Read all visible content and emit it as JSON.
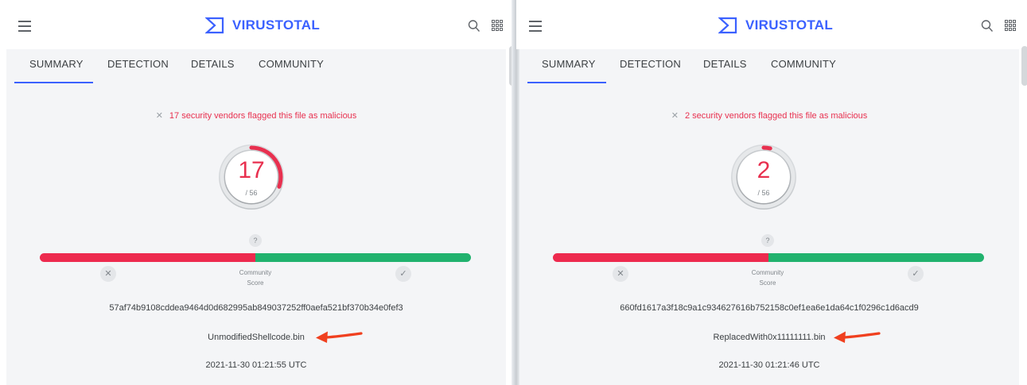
{
  "colors": {
    "brand": "#3b61ff",
    "malicious": "#e8304f",
    "bar_red": "#ed2a4e",
    "bar_green": "#21b26e",
    "annotation_arrow": "#f0401f"
  },
  "panels": [
    {
      "brand_name": "VIRUSTOTAL",
      "tabs": [
        "SUMMARY",
        "DETECTION",
        "DETAILS",
        "COMMUNITY"
      ],
      "active_tab": "SUMMARY",
      "flag_icon": "x-icon",
      "flag_text": "17 security vendors flagged this file as malicious",
      "score": "17",
      "score_total": "/ 56",
      "score_fraction": 0.3036,
      "question_mark": "?",
      "community_score_label": "Community\nScore",
      "community_score_fraction": 0.5,
      "hash": "57af74b9108cddea9464d0d682995ab849037252ff0aefa521bf370b34e0fef3",
      "filename": "UnmodifiedShellcode.bin",
      "date": "2021-11-30 01:21:55 UTC"
    },
    {
      "brand_name": "VIRUSTOTAL",
      "tabs": [
        "SUMMARY",
        "DETECTION",
        "DETAILS",
        "COMMUNITY"
      ],
      "active_tab": "SUMMARY",
      "flag_icon": "x-icon",
      "flag_text": "2 security vendors flagged this file as malicious",
      "score": "2",
      "score_total": "/ 56",
      "score_fraction": 0.0357,
      "question_mark": "?",
      "community_score_label": "Community\nScore",
      "community_score_fraction": 0.5,
      "hash": "660fd1617a3f18c9a1c934627616b752158c0ef1ea6e1da64c1f0296c1d6acd9",
      "filename": "ReplacedWith0x11111111.bin",
      "date": "2021-11-30 01:21:46 UTC"
    }
  ]
}
